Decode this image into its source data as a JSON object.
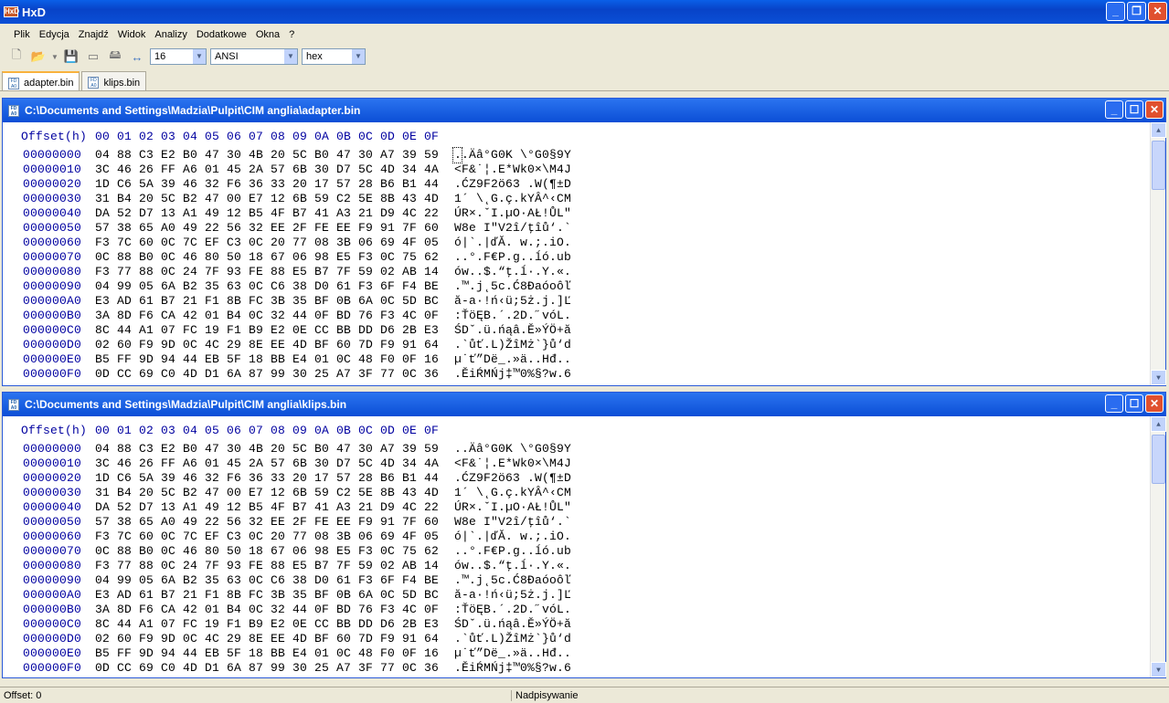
{
  "app": {
    "title": "HxD"
  },
  "menu": [
    "Plik",
    "Edycja",
    "Znajdź",
    "Widok",
    "Analizy",
    "Dodatkowe",
    "Okna",
    "?"
  ],
  "toolbar": {
    "bytes_per_row": "16",
    "charset": "ANSI",
    "offset_base": "hex"
  },
  "tabs": [
    {
      "label": "adapter.bin",
      "active": true
    },
    {
      "label": "klips.bin",
      "active": false
    }
  ],
  "header": {
    "offset_label": "Offset(h)",
    "columns": [
      "00",
      "01",
      "02",
      "03",
      "04",
      "05",
      "06",
      "07",
      "08",
      "09",
      "0A",
      "0B",
      "0C",
      "0D",
      "0E",
      "0F"
    ]
  },
  "rows": [
    {
      "offset": "00000000",
      "hex": "04 88 C3 E2 B0 47 30 4B 20 5C B0 47 30 A7 39 59",
      "text": "..Äâ°G0K \\°G0§9Y"
    },
    {
      "offset": "00000010",
      "hex": "3C 46 26 FF A6 01 45 2A 57 6B 30 D7 5C 4D 34 4A",
      "text": "<F&˙¦.E*Wk0×\\M4J"
    },
    {
      "offset": "00000020",
      "hex": "1D C6 5A 39 46 32 F6 36 33 20 17 57 28 B6 B1 44",
      "text": ".ĆZ9F2ö63 .W(¶±D"
    },
    {
      "offset": "00000030",
      "hex": "31 B4 20 5C B2 47 00 E7 12 6B 59 C2 5E 8B 43 4D",
      "text": "1´ \\˛G.ç.kYÂ^‹CM"
    },
    {
      "offset": "00000040",
      "hex": "DA 52 D7 13 A1 49 12 B5 4F B7 41 A3 21 D9 4C 22",
      "text": "ÚR×.ˇI.µO·AŁ!ŮL\""
    },
    {
      "offset": "00000050",
      "hex": "57 38 65 A0 49 22 56 32 EE 2F FE EE F9 91 7F 60",
      "text": "W8e I\"V2î/ţîů‘.`"
    },
    {
      "offset": "00000060",
      "hex": "F3 7C 60 0C 7C EF C3 0C 20 77 08 3B 06 69 4F 05",
      "text": "ó|`.|ďĂ. w.;.iO."
    },
    {
      "offset": "00000070",
      "hex": "0C 88 B0 0C 46 80 50 18 67 06 98 E5 F3 0C 75 62",
      "text": "..°.F€P.g..ĺó.ub"
    },
    {
      "offset": "00000080",
      "hex": "F3 77 88 0C 24 7F 93 FE 88 E5 B7 7F 59 02 AB 14",
      "text": "ów..$.“ţ.ĺ·.Y.«."
    },
    {
      "offset": "00000090",
      "hex": "04 99 05 6A B2 35 63 0C C6 38 D0 61 F3 6F F4 BE",
      "text": ".™.j˛5c.Ć8Đaóoôľ"
    },
    {
      "offset": "000000A0",
      "hex": "E3 AD 61 B7 21 F1 8B FC 3B 35 BF 0B 6A 0C 5D BC",
      "text": "ă-a·!ń‹ü;5ż.j.]Ľ"
    },
    {
      "offset": "000000B0",
      "hex": "3A 8D F6 CA 42 01 B4 0C 32 44 0F BD 76 F3 4C 0F",
      "text": ":ŤöĘB.´.2D.˝vóL."
    },
    {
      "offset": "000000C0",
      "hex": "8C 44 A1 07 FC 19 F1 B9 E2 0E CC BB DD D6 2B E3",
      "text": "ŚDˇ.ü.ńąâ.Ě»ÝÖ+ă"
    },
    {
      "offset": "000000D0",
      "hex": "02 60 F9 9D 0C 4C 29 8E EE 4D BF 60 7D F9 91 64",
      "text": ".`ůť.L)ŽîMż`}ů‘d"
    },
    {
      "offset": "000000E0",
      "hex": "B5 FF 9D 94 44 EB 5F 18 BB E4 01 0C 48 F0 0F 16",
      "text": "µ˙ť”Dë_.»ä..Hđ.."
    },
    {
      "offset": "000000F0",
      "hex": "0D CC 69 C0 4D D1 6A 87 99 30 25 A7 3F 77 0C 36",
      "text": ".ĚiŔMŃj‡™0%§?w.6"
    }
  ],
  "panes": [
    {
      "title": "C:\\Documents and Settings\\Madzia\\Pulpit\\CIM anglia\\adapter.bin"
    },
    {
      "title": "C:\\Documents and Settings\\Madzia\\Pulpit\\CIM anglia\\klips.bin"
    }
  ],
  "status": {
    "offset": "Offset: 0",
    "mode": "Nadpisywanie"
  }
}
